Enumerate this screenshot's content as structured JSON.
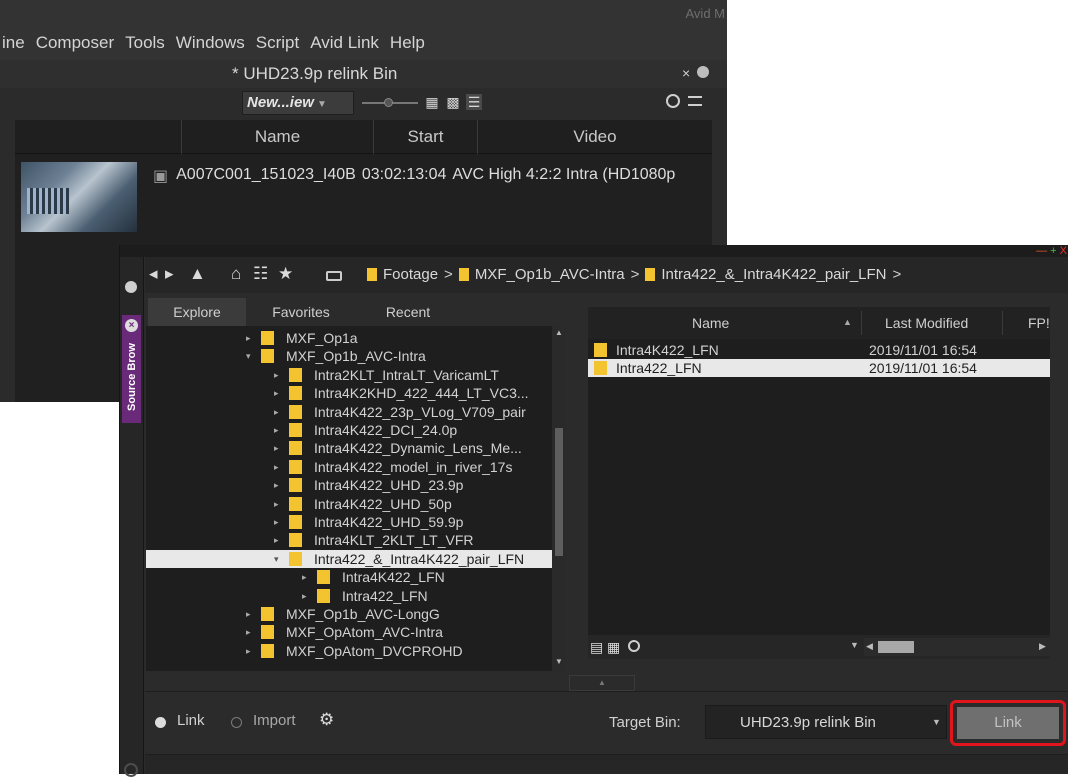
{
  "app": {
    "title_fragment": "Avid M"
  },
  "menubar": {
    "items": [
      "ine",
      "Composer",
      "Tools",
      "Windows",
      "Script",
      "Avid Link",
      "Help"
    ]
  },
  "bin": {
    "title": "* UHD23.9p relink Bin",
    "close_glyph": "×",
    "view_selector": "New...iew",
    "columns": [
      "Name",
      "Start",
      "Video"
    ],
    "clip": {
      "name": "A007C001_151023_I40B",
      "start": "03:02:13:04",
      "video": "AVC High 4:2:2 Intra (HD1080p"
    }
  },
  "source_browser": {
    "side_tab_label": "Source Brow",
    "window_controls": [
      "—",
      "+",
      "X"
    ],
    "breadcrumb": [
      "Footage",
      "MXF_Op1b_AVC-Intra",
      "Intra422_&_Intra4K422_pair_LFN"
    ],
    "breadcrumb_separator": ">",
    "tabs": [
      "Explore",
      "Favorites",
      "Recent"
    ],
    "tree": [
      {
        "label": "MXF_Op1a",
        "level": 0,
        "twisty": "▸",
        "selected": false
      },
      {
        "label": "MXF_Op1b_AVC-Intra",
        "level": 0,
        "twisty": "▾",
        "selected": false
      },
      {
        "label": "Intra2KLT_IntraLT_VaricamLT",
        "level": 1,
        "twisty": "▸",
        "selected": false
      },
      {
        "label": "Intra4K2KHD_422_444_LT_VC3...",
        "level": 1,
        "twisty": "▸",
        "selected": false
      },
      {
        "label": "Intra4K422_23p_VLog_V709_pair",
        "level": 1,
        "twisty": "▸",
        "selected": false
      },
      {
        "label": "Intra4K422_DCI_24.0p",
        "level": 1,
        "twisty": "▸",
        "selected": false
      },
      {
        "label": "Intra4K422_Dynamic_Lens_Me...",
        "level": 1,
        "twisty": "▸",
        "selected": false
      },
      {
        "label": "Intra4K422_model_in_river_17s",
        "level": 1,
        "twisty": "▸",
        "selected": false
      },
      {
        "label": "Intra4K422_UHD_23.9p",
        "level": 1,
        "twisty": "▸",
        "selected": false
      },
      {
        "label": "Intra4K422_UHD_50p",
        "level": 1,
        "twisty": "▸",
        "selected": false
      },
      {
        "label": "Intra4K422_UHD_59.9p",
        "level": 1,
        "twisty": "▸",
        "selected": false
      },
      {
        "label": "Intra4KLT_2KLT_LT_VFR",
        "level": 1,
        "twisty": "▸",
        "selected": false
      },
      {
        "label": "Intra422_&_Intra4K422_pair_LFN",
        "level": 1,
        "twisty": "▾",
        "selected": true
      },
      {
        "label": "Intra4K422_LFN",
        "level": 2,
        "twisty": "▸",
        "selected": false
      },
      {
        "label": "Intra422_LFN",
        "level": 2,
        "twisty": "▸",
        "selected": false
      },
      {
        "label": "MXF_Op1b_AVC-LongG",
        "level": 0,
        "twisty": "▸",
        "selected": false
      },
      {
        "label": "MXF_OpAtom_AVC-Intra",
        "level": 0,
        "twisty": "▸",
        "selected": false
      },
      {
        "label": "MXF_OpAtom_DVCPROHD",
        "level": 0,
        "twisty": "▸",
        "selected": false
      }
    ],
    "file_columns": [
      "Name",
      "Last Modified",
      "FP!"
    ],
    "files": [
      {
        "name": "Intra4K422_LFN",
        "modified": "2019/11/01 16:54",
        "selected": false
      },
      {
        "name": "Intra422_LFN",
        "modified": "2019/11/01 16:54",
        "selected": true
      }
    ],
    "mode_link": "Link",
    "mode_import": "Import",
    "target_bin_label": "Target Bin:",
    "target_bin_value": "UHD23.9p relink Bin",
    "link_button": "Link"
  },
  "colors": {
    "folder": "#f4c430",
    "accent_highlight": "#e2141c",
    "side_tab": "#6a2a7a"
  }
}
